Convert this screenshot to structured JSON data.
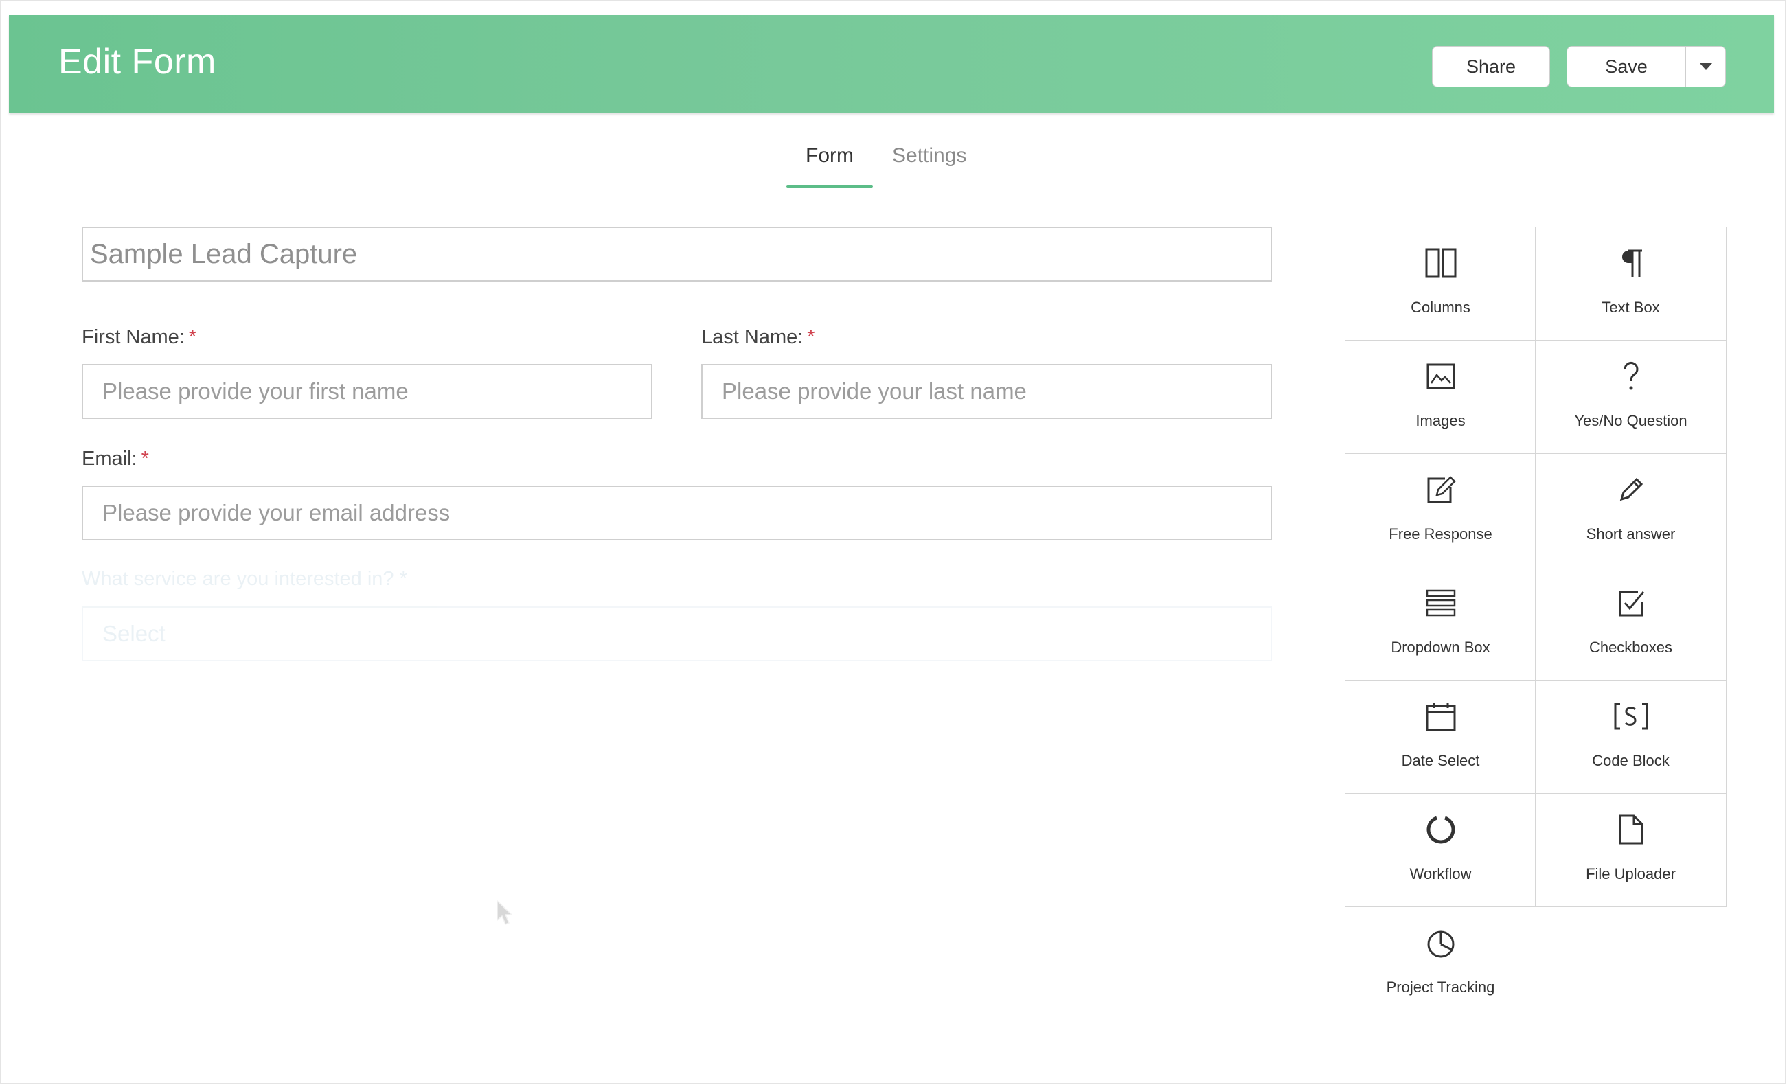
{
  "header": {
    "title": "Edit Form",
    "share_label": "Share",
    "save_label": "Save"
  },
  "tabs": [
    {
      "label": "Form",
      "active": true
    },
    {
      "label": "Settings",
      "active": false
    }
  ],
  "form": {
    "title_value": "Sample Lead Capture",
    "first_name": {
      "label": "First Name:",
      "required": "*",
      "placeholder": "Please provide your first name"
    },
    "last_name": {
      "label": "Last Name:",
      "required": "*",
      "placeholder": "Please provide your last name"
    },
    "email": {
      "label": "Email:",
      "required": "*",
      "placeholder": "Please provide your email address"
    },
    "service": {
      "label": "What service are you interested in?",
      "required": "*",
      "select_value": "Select"
    }
  },
  "palette": [
    {
      "label": "Columns",
      "icon": "columns-icon"
    },
    {
      "label": "Text Box",
      "icon": "paragraph-icon"
    },
    {
      "label": "Images",
      "icon": "image-icon"
    },
    {
      "label": "Yes/No Question",
      "icon": "question-icon"
    },
    {
      "label": "Free Response",
      "icon": "edit-box-icon"
    },
    {
      "label": "Short answer",
      "icon": "pencil-icon"
    },
    {
      "label": "Dropdown Box",
      "icon": "list-icon"
    },
    {
      "label": "Checkboxes",
      "icon": "checkbox-icon"
    },
    {
      "label": "Date Select",
      "icon": "calendar-icon"
    },
    {
      "label": "Code Block",
      "icon": "code-block-icon"
    },
    {
      "label": "Workflow",
      "icon": "circle-arrow-icon"
    },
    {
      "label": "File Uploader",
      "icon": "file-icon"
    },
    {
      "label": "Project Tracking",
      "icon": "pie-chart-icon"
    }
  ],
  "colors": {
    "header_start": "#6bc491",
    "header_end": "#7fd2a0",
    "tab_underline": "#5cbd88",
    "required": "#d0424e"
  }
}
